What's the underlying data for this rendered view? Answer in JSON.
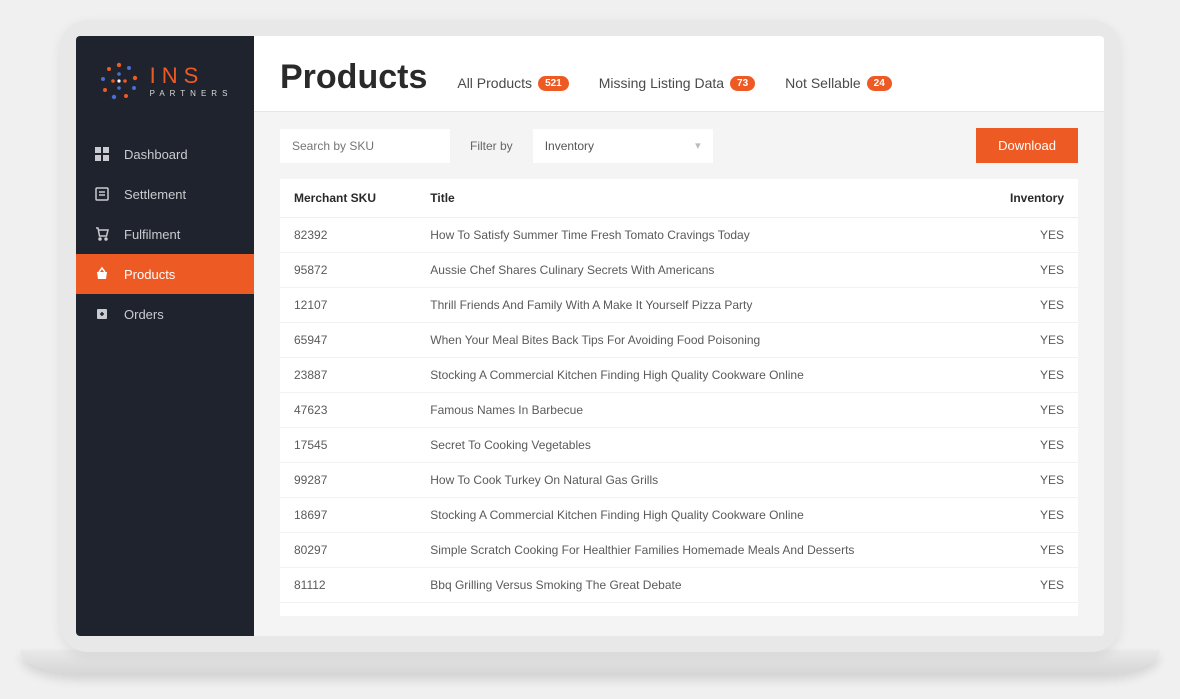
{
  "logo": {
    "brand": "INS",
    "sub": "PARTNERS"
  },
  "sidebar": {
    "items": [
      {
        "label": "Dashboard",
        "icon": "dashboard",
        "active": false
      },
      {
        "label": "Settlement",
        "icon": "settlement",
        "active": false
      },
      {
        "label": "Fulfilment",
        "icon": "fulfilment",
        "active": false
      },
      {
        "label": "Products",
        "icon": "products",
        "active": true
      },
      {
        "label": "Orders",
        "icon": "orders",
        "active": false
      }
    ]
  },
  "header": {
    "title": "Products",
    "tabs": [
      {
        "label": "All Products",
        "count": "521"
      },
      {
        "label": "Missing Listing Data",
        "count": "73"
      },
      {
        "label": "Not Sellable",
        "count": "24"
      }
    ]
  },
  "toolbar": {
    "search_placeholder": "Search by SKU",
    "filter_label": "Filter by",
    "filter_value": "Inventory",
    "download_label": "Download"
  },
  "table": {
    "columns": [
      "Merchant SKU",
      "Title",
      "Inventory"
    ],
    "rows": [
      {
        "sku": "82392",
        "title": "How To Satisfy Summer Time Fresh Tomato Cravings Today",
        "inventory": "YES"
      },
      {
        "sku": "95872",
        "title": "Aussie Chef Shares Culinary Secrets With Americans",
        "inventory": "YES"
      },
      {
        "sku": "12107",
        "title": "Thrill Friends And Family With A Make It Yourself Pizza Party",
        "inventory": "YES"
      },
      {
        "sku": "65947",
        "title": "When Your Meal Bites Back Tips For Avoiding Food Poisoning",
        "inventory": "YES"
      },
      {
        "sku": "23887",
        "title": "Stocking A Commercial Kitchen Finding High Quality Cookware Online",
        "inventory": "YES"
      },
      {
        "sku": "47623",
        "title": "Famous Names In Barbecue",
        "inventory": "YES"
      },
      {
        "sku": "17545",
        "title": "Secret To Cooking Vegetables",
        "inventory": "YES"
      },
      {
        "sku": "99287",
        "title": "How To Cook Turkey On Natural Gas Grills",
        "inventory": "YES"
      },
      {
        "sku": "18697",
        "title": "Stocking A Commercial Kitchen Finding High Quality Cookware Online",
        "inventory": "YES"
      },
      {
        "sku": "80297",
        "title": "Simple Scratch Cooking For Healthier Families Homemade Meals And Desserts",
        "inventory": "YES"
      },
      {
        "sku": "81112",
        "title": "Bbq Grilling Versus Smoking The Great Debate",
        "inventory": "YES"
      }
    ]
  },
  "colors": {
    "accent": "#ee5a24",
    "sidebar_bg": "#1f232d"
  }
}
